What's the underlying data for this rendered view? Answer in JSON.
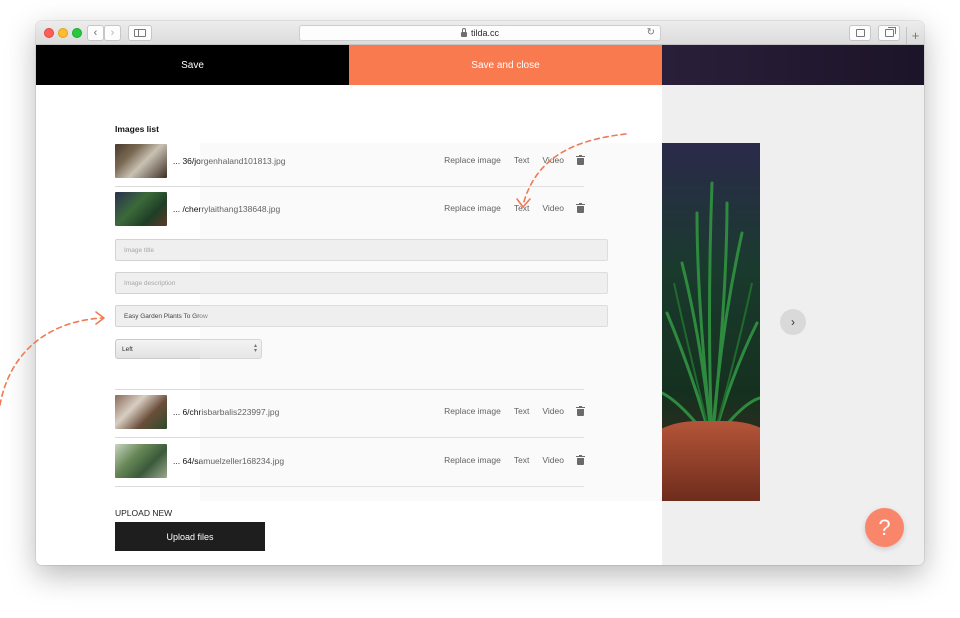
{
  "browser": {
    "url": "tilda.cc",
    "nav_back": "‹",
    "nav_forward": "›",
    "reload": "↻",
    "new_tab": "+"
  },
  "toolbar": {
    "save_label": "Save",
    "save_close_label": "Save and close"
  },
  "images_list": {
    "title": "Images list",
    "items": [
      {
        "filename": "... 36/jorgenhaland101813.jpg",
        "replace_label": "Replace image",
        "text_label": "Text",
        "video_label": "Video"
      },
      {
        "filename": "... /cherrylaithang138648.jpg",
        "replace_label": "Replace image",
        "text_label": "Text",
        "video_label": "Video"
      },
      {
        "filename": "... 6/chrisbarbalis223997.jpg",
        "replace_label": "Replace image",
        "text_label": "Text",
        "video_label": "Video"
      },
      {
        "filename": "... 64/samuelzeller168234.jpg",
        "replace_label": "Replace image",
        "text_label": "Text",
        "video_label": "Video"
      }
    ]
  },
  "edit_form": {
    "image_title_placeholder": "Image title",
    "image_description_placeholder": "Image description",
    "alt_value": "Easy Garden Plants To Grow",
    "align_value": "Left"
  },
  "upload": {
    "label": "UPLOAD NEW",
    "button_label": "Upload files"
  },
  "preview": {
    "next_arrow": "›",
    "help_label": "?"
  },
  "colors": {
    "accent": "#fa7a4f",
    "help": "#f9866b",
    "save_bg": "#000000",
    "upload_bg": "#1e1e1e"
  }
}
